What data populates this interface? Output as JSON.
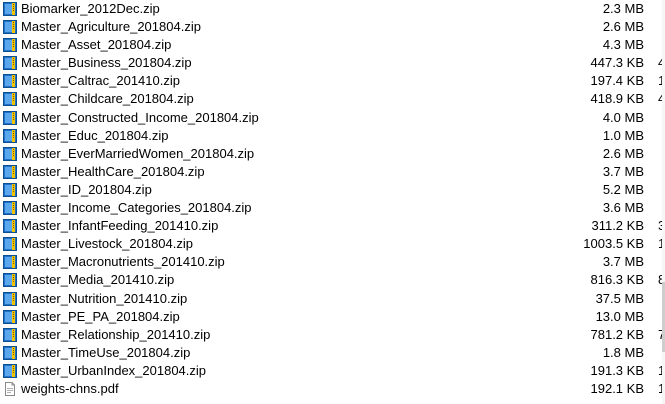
{
  "files": [
    {
      "name": "Biomarker_2012Dec.zip",
      "size": "2.3 MB",
      "type": "zip",
      "extra": ""
    },
    {
      "name": "Master_Agriculture_201804.zip",
      "size": "2.6 MB",
      "type": "zip",
      "extra": ""
    },
    {
      "name": "Master_Asset_201804.zip",
      "size": "4.3 MB",
      "type": "zip",
      "extra": ""
    },
    {
      "name": "Master_Business_201804.zip",
      "size": "447.3 KB",
      "type": "zip",
      "extra": "4"
    },
    {
      "name": "Master_Caltrac_201410.zip",
      "size": "197.4 KB",
      "type": "zip",
      "extra": "1"
    },
    {
      "name": "Master_Childcare_201804.zip",
      "size": "418.9 KB",
      "type": "zip",
      "extra": "4"
    },
    {
      "name": "Master_Constructed_Income_201804.zip",
      "size": "4.0 MB",
      "type": "zip",
      "extra": ""
    },
    {
      "name": "Master_Educ_201804.zip",
      "size": "1.0 MB",
      "type": "zip",
      "extra": ""
    },
    {
      "name": "Master_EverMarriedWomen_201804.zip",
      "size": "2.6 MB",
      "type": "zip",
      "extra": ""
    },
    {
      "name": "Master_HealthCare_201804.zip",
      "size": "3.7 MB",
      "type": "zip",
      "extra": ""
    },
    {
      "name": "Master_ID_201804.zip",
      "size": "5.2 MB",
      "type": "zip",
      "extra": ""
    },
    {
      "name": "Master_Income_Categories_201804.zip",
      "size": "3.6 MB",
      "type": "zip",
      "extra": ""
    },
    {
      "name": "Master_InfantFeeding_201410.zip",
      "size": "311.2 KB",
      "type": "zip",
      "extra": "3"
    },
    {
      "name": "Master_Livestock_201804.zip",
      "size": "1003.5 KB",
      "type": "zip",
      "extra": "1("
    },
    {
      "name": "Master_Macronutrients_201410.zip",
      "size": "3.7 MB",
      "type": "zip",
      "extra": ""
    },
    {
      "name": "Master_Media_201410.zip",
      "size": "816.3 KB",
      "type": "zip",
      "extra": "8"
    },
    {
      "name": "Master_Nutrition_201410.zip",
      "size": "37.5 MB",
      "type": "zip",
      "extra": ""
    },
    {
      "name": "Master_PE_PA_201804.zip",
      "size": "13.0 MB",
      "type": "zip",
      "extra": ""
    },
    {
      "name": "Master_Relationship_201410.zip",
      "size": "781.2 KB",
      "type": "zip",
      "extra": "7"
    },
    {
      "name": "Master_TimeUse_201804.zip",
      "size": "1.8 MB",
      "type": "zip",
      "extra": ""
    },
    {
      "name": "Master_UrbanIndex_201804.zip",
      "size": "191.3 KB",
      "type": "zip",
      "extra": "1"
    },
    {
      "name": "weights-chns.pdf",
      "size": "192.1 KB",
      "type": "pdf",
      "extra": "1"
    }
  ],
  "colors": {
    "zip_icon_bg": "#1e73c8",
    "zip_icon_stripe": "#f2c200",
    "pdf_icon": "#8a8a8a"
  }
}
